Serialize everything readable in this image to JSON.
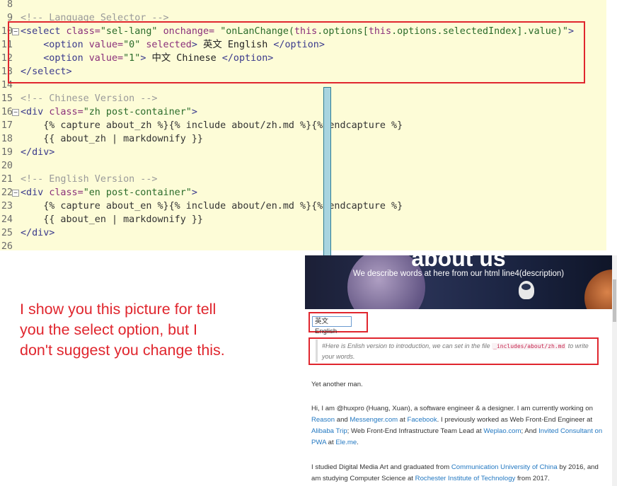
{
  "editor": {
    "lines": [
      {
        "num": "8",
        "fold": "",
        "segments": []
      },
      {
        "num": "9",
        "fold": "",
        "segments": [
          {
            "cls": "c-comment",
            "text": "<!-- Language Selector -->"
          }
        ]
      },
      {
        "num": "10",
        "fold": "−",
        "segments": [
          {
            "cls": "c-tag",
            "text": "<select "
          },
          {
            "cls": "c-attr",
            "text": "class="
          },
          {
            "cls": "c-str",
            "text": "\"sel-lang\" "
          },
          {
            "cls": "c-attr",
            "text": "onchange= "
          },
          {
            "cls": "c-str",
            "text": "\"onLanChange("
          },
          {
            "cls": "c-kw",
            "text": "this"
          },
          {
            "cls": "c-str",
            "text": ".options["
          },
          {
            "cls": "c-kw",
            "text": "this"
          },
          {
            "cls": "c-str",
            "text": ".options.selectedIndex].value)\""
          },
          {
            "cls": "c-tag",
            "text": ">"
          }
        ]
      },
      {
        "num": "11",
        "fold": "",
        "segments": [
          {
            "cls": "c-plain",
            "text": "    "
          },
          {
            "cls": "c-tag",
            "text": "<option "
          },
          {
            "cls": "c-attr",
            "text": "value="
          },
          {
            "cls": "c-str",
            "text": "\"0\" "
          },
          {
            "cls": "c-attr",
            "text": "selected"
          },
          {
            "cls": "c-tag",
            "text": "> "
          },
          {
            "cls": "c-plain",
            "text": "英文 English "
          },
          {
            "cls": "c-tag",
            "text": "</option>"
          }
        ]
      },
      {
        "num": "12",
        "fold": "",
        "segments": [
          {
            "cls": "c-plain",
            "text": "    "
          },
          {
            "cls": "c-tag",
            "text": "<option "
          },
          {
            "cls": "c-attr",
            "text": "value="
          },
          {
            "cls": "c-str",
            "text": "\"1\""
          },
          {
            "cls": "c-tag",
            "text": "> "
          },
          {
            "cls": "c-plain",
            "text": "中文 Chinese "
          },
          {
            "cls": "c-tag",
            "text": "</option>"
          }
        ]
      },
      {
        "num": "13",
        "fold": "",
        "segments": [
          {
            "cls": "c-tag",
            "text": "</select>"
          }
        ]
      },
      {
        "num": "14",
        "fold": "",
        "segments": []
      },
      {
        "num": "15",
        "fold": "",
        "segments": [
          {
            "cls": "c-comment",
            "text": "<!-- Chinese Version -->"
          }
        ]
      },
      {
        "num": "16",
        "fold": "−",
        "segments": [
          {
            "cls": "c-tag",
            "text": "<div "
          },
          {
            "cls": "c-attr",
            "text": "class="
          },
          {
            "cls": "c-str",
            "text": "\"zh post-container\""
          },
          {
            "cls": "c-tag",
            "text": ">"
          }
        ]
      },
      {
        "num": "17",
        "fold": "",
        "segments": [
          {
            "cls": "c-liquid",
            "text": "    {% capture about_zh %}{% include about/zh.md %}{% endcapture %}"
          }
        ]
      },
      {
        "num": "18",
        "fold": "",
        "segments": [
          {
            "cls": "c-liquid",
            "text": "    {{ about_zh | markdownify }}"
          }
        ]
      },
      {
        "num": "19",
        "fold": "",
        "segments": [
          {
            "cls": "c-tag",
            "text": "</div>"
          }
        ]
      },
      {
        "num": "20",
        "fold": "",
        "segments": []
      },
      {
        "num": "21",
        "fold": "",
        "segments": [
          {
            "cls": "c-comment",
            "text": "<!-- English Version -->"
          }
        ]
      },
      {
        "num": "22",
        "fold": "−",
        "segments": [
          {
            "cls": "c-tag",
            "text": "<div "
          },
          {
            "cls": "c-attr",
            "text": "class="
          },
          {
            "cls": "c-str",
            "text": "\"en post-container\""
          },
          {
            "cls": "c-tag",
            "text": ">"
          }
        ]
      },
      {
        "num": "23",
        "fold": "",
        "segments": [
          {
            "cls": "c-liquid",
            "text": "    {% capture about_en %}{% include about/en.md %}{% endcapture %}"
          }
        ]
      },
      {
        "num": "24",
        "fold": "",
        "segments": [
          {
            "cls": "c-liquid",
            "text": "    {{ about_en | markdownify }}"
          }
        ]
      },
      {
        "num": "25",
        "fold": "",
        "segments": [
          {
            "cls": "c-tag",
            "text": "</div>"
          }
        ]
      },
      {
        "num": "26",
        "fold": "",
        "segments": []
      }
    ]
  },
  "annotation": {
    "text": "I show you this picture for tell you the select option, but I don't suggest you change this."
  },
  "site": {
    "hero_title": "about us",
    "hero_desc": "We describe words at here from our html line4(description)",
    "select_value": "英文 English",
    "quote_pre": "#Here is Enlish version to introduction, we can set in the file ",
    "quote_code": "_includes/about/zh.md",
    "quote_post": " to write your words.",
    "p1": "Yet another man.",
    "p2": [
      {
        "t": "Hi, I am @huxpro (Huang, Xuan), a software engineer & a designer. I am currently working on ",
        "link": false
      },
      {
        "t": "Reason",
        "link": true
      },
      {
        "t": " and ",
        "link": false
      },
      {
        "t": "Messenger.com",
        "link": true
      },
      {
        "t": " at ",
        "link": false
      },
      {
        "t": "Facebook",
        "link": true
      },
      {
        "t": ". I previously worked as Web Front-End Engineer at ",
        "link": false
      },
      {
        "t": "Alibaba Trip",
        "link": true
      },
      {
        "t": "; Web Front-End Infrastructure Team Lead at ",
        "link": false
      },
      {
        "t": "Weplao.com",
        "link": true
      },
      {
        "t": "; And ",
        "link": false
      },
      {
        "t": "Invited Consultant on PWA",
        "link": true
      },
      {
        "t": " at ",
        "link": false
      },
      {
        "t": "Ele.me",
        "link": true
      },
      {
        "t": ".",
        "link": false
      }
    ],
    "p3": [
      {
        "t": "I studied Digital Media Art and graduated from ",
        "link": false
      },
      {
        "t": "Communication University of China",
        "link": true
      },
      {
        "t": " by 2016, and am studying Computer Science at ",
        "link": false
      },
      {
        "t": "Rochester Institute of Technology",
        "link": true
      },
      {
        "t": " from 2017.",
        "link": false
      }
    ]
  }
}
